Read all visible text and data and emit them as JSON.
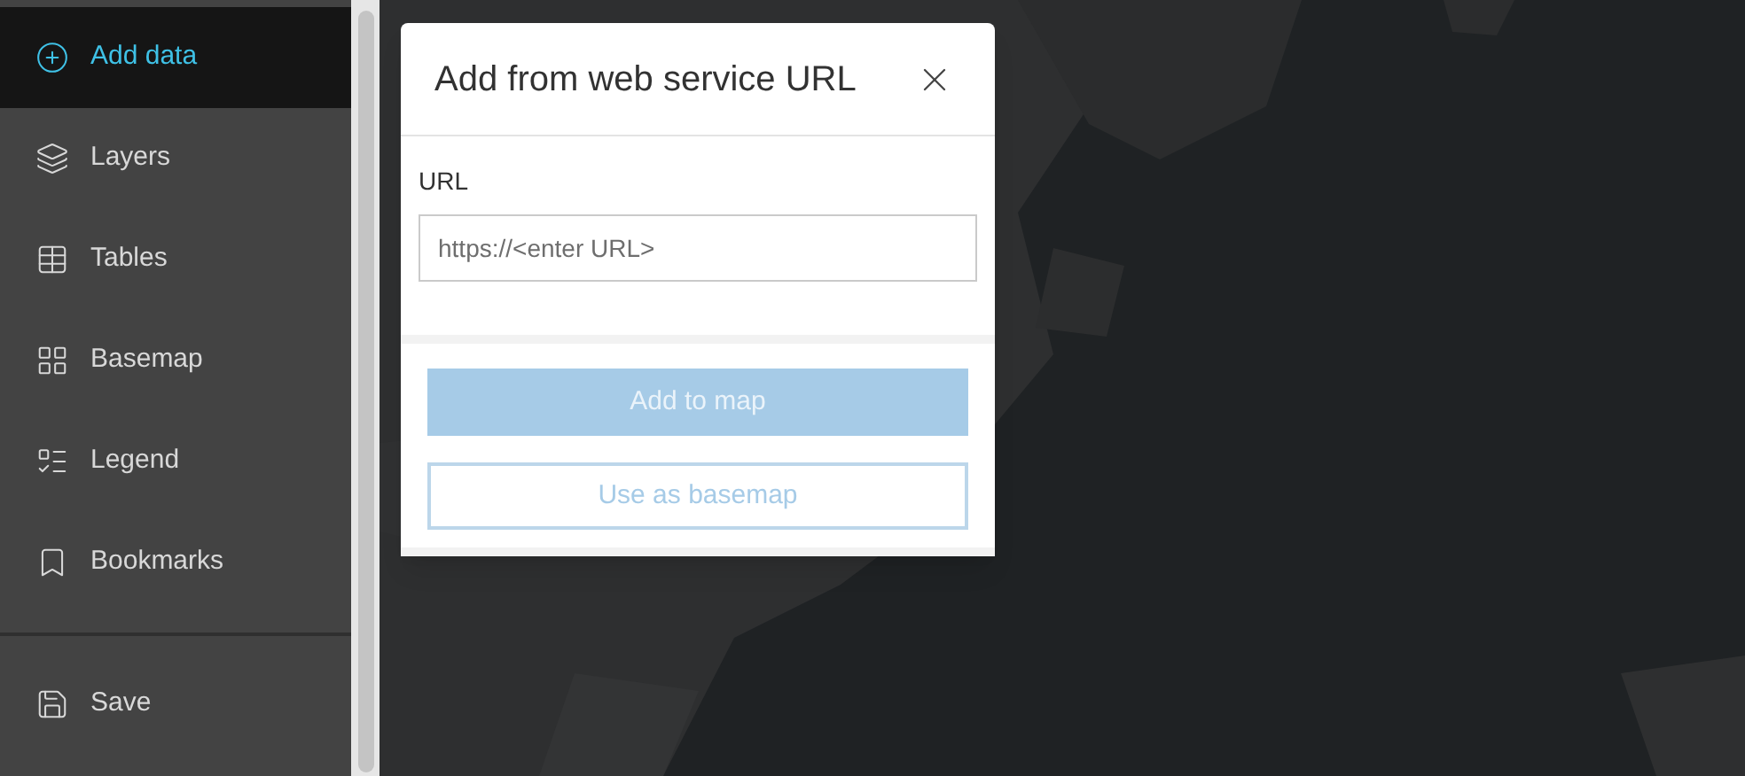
{
  "sidebar": {
    "items": [
      {
        "label": "Add data",
        "selected": true
      },
      {
        "label": "Layers",
        "selected": false
      },
      {
        "label": "Tables",
        "selected": false
      },
      {
        "label": "Basemap",
        "selected": false
      },
      {
        "label": "Legend",
        "selected": false
      },
      {
        "label": "Bookmarks",
        "selected": false
      }
    ],
    "footer_items": [
      {
        "label": "Save",
        "selected": false
      }
    ]
  },
  "dialog": {
    "title": "Add from web service URL",
    "url_label": "URL",
    "url_field": {
      "placeholder": "https://<enter URL>"
    },
    "buttons": [
      {
        "label": "Add to map",
        "kind": "primary",
        "disabled": true
      },
      {
        "label": "Use as basemap",
        "kind": "secondary",
        "disabled": true
      }
    ]
  }
}
